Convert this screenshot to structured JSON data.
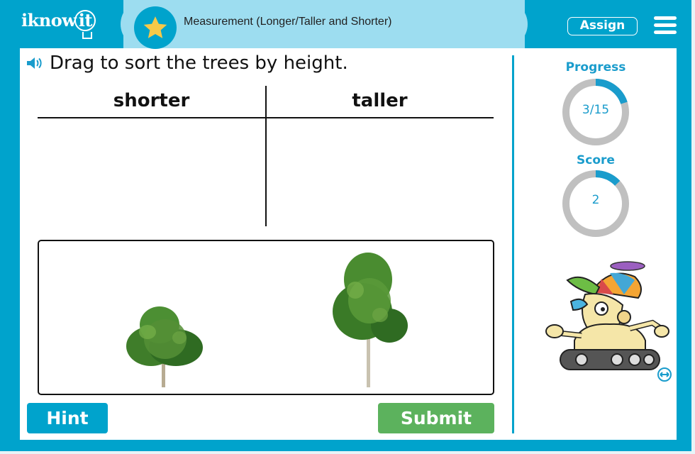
{
  "header": {
    "logo": "iknowit",
    "lesson_title": "Measurement (Longer/Taller and Shorter)",
    "assign_label": "Assign",
    "icons": {
      "badge": "star-icon",
      "menu": "hamburger-menu-icon"
    }
  },
  "question": {
    "prompt": "Drag to sort the trees by height.",
    "audio_icon": "speaker-icon"
  },
  "sort_table": {
    "columns": [
      {
        "label": "shorter",
        "items": []
      },
      {
        "label": "taller",
        "items": []
      }
    ]
  },
  "tray": {
    "items": [
      {
        "name": "short-tree",
        "relative_height": "shorter"
      },
      {
        "name": "tall-tree",
        "relative_height": "taller"
      }
    ]
  },
  "buttons": {
    "hint": "Hint",
    "submit": "Submit"
  },
  "sidebar": {
    "progress": {
      "label": "Progress",
      "value_text": "3/15",
      "current": 3,
      "total": 15
    },
    "score": {
      "label": "Score",
      "value_text": "2",
      "fraction": 0.13
    },
    "mascot": "robot-mascot",
    "expand_icon": "expand-arrows-icon"
  },
  "colors": {
    "brand_teal": "#00a3cc",
    "title_bar": "#9dddf0",
    "star": "#f7c948",
    "submit_green": "#5cb25d",
    "ring_gray": "#c0c0c0",
    "stat_blue": "#1a9ccc"
  }
}
